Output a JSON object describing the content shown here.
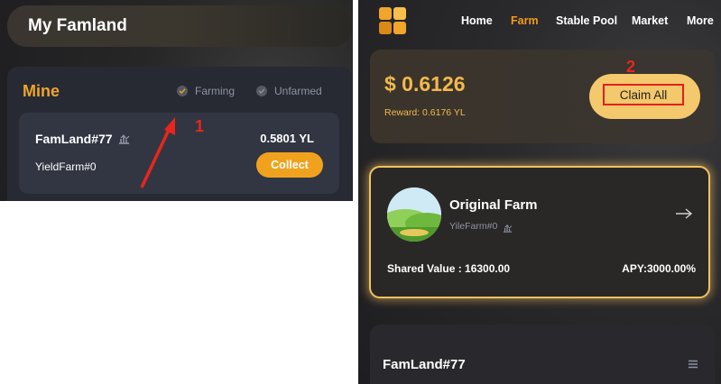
{
  "left": {
    "title": "My Famland",
    "mine": {
      "title": "Mine",
      "filters": [
        {
          "label": "Farming",
          "checked": true
        },
        {
          "label": "Unfarmed",
          "checked": false
        }
      ],
      "item": {
        "name": "FamLand#77",
        "yield": "0.5801 YL",
        "sub": "YieldFarm#0",
        "collect_label": "Collect"
      }
    },
    "annotation": "1"
  },
  "right": {
    "nav": [
      "Home",
      "Farm",
      "Stable Pool",
      "Market",
      "More"
    ],
    "active_nav": "Farm",
    "balance": {
      "value": "$ 0.6126",
      "reward": "Reward: 0.6176 YL",
      "claim_label": "Claim All",
      "annotation": "2"
    },
    "farm": {
      "name": "Original Farm",
      "sub": "YileFarm#0",
      "shared_value": "Shared Value : 16300.00",
      "apy": "APY:3000.00%"
    },
    "famland": {
      "title": "FamLand#77"
    }
  },
  "colors": {
    "accent": "#f0a21e",
    "annotation": "#e8261c",
    "highlight_border": "#f6c160"
  }
}
